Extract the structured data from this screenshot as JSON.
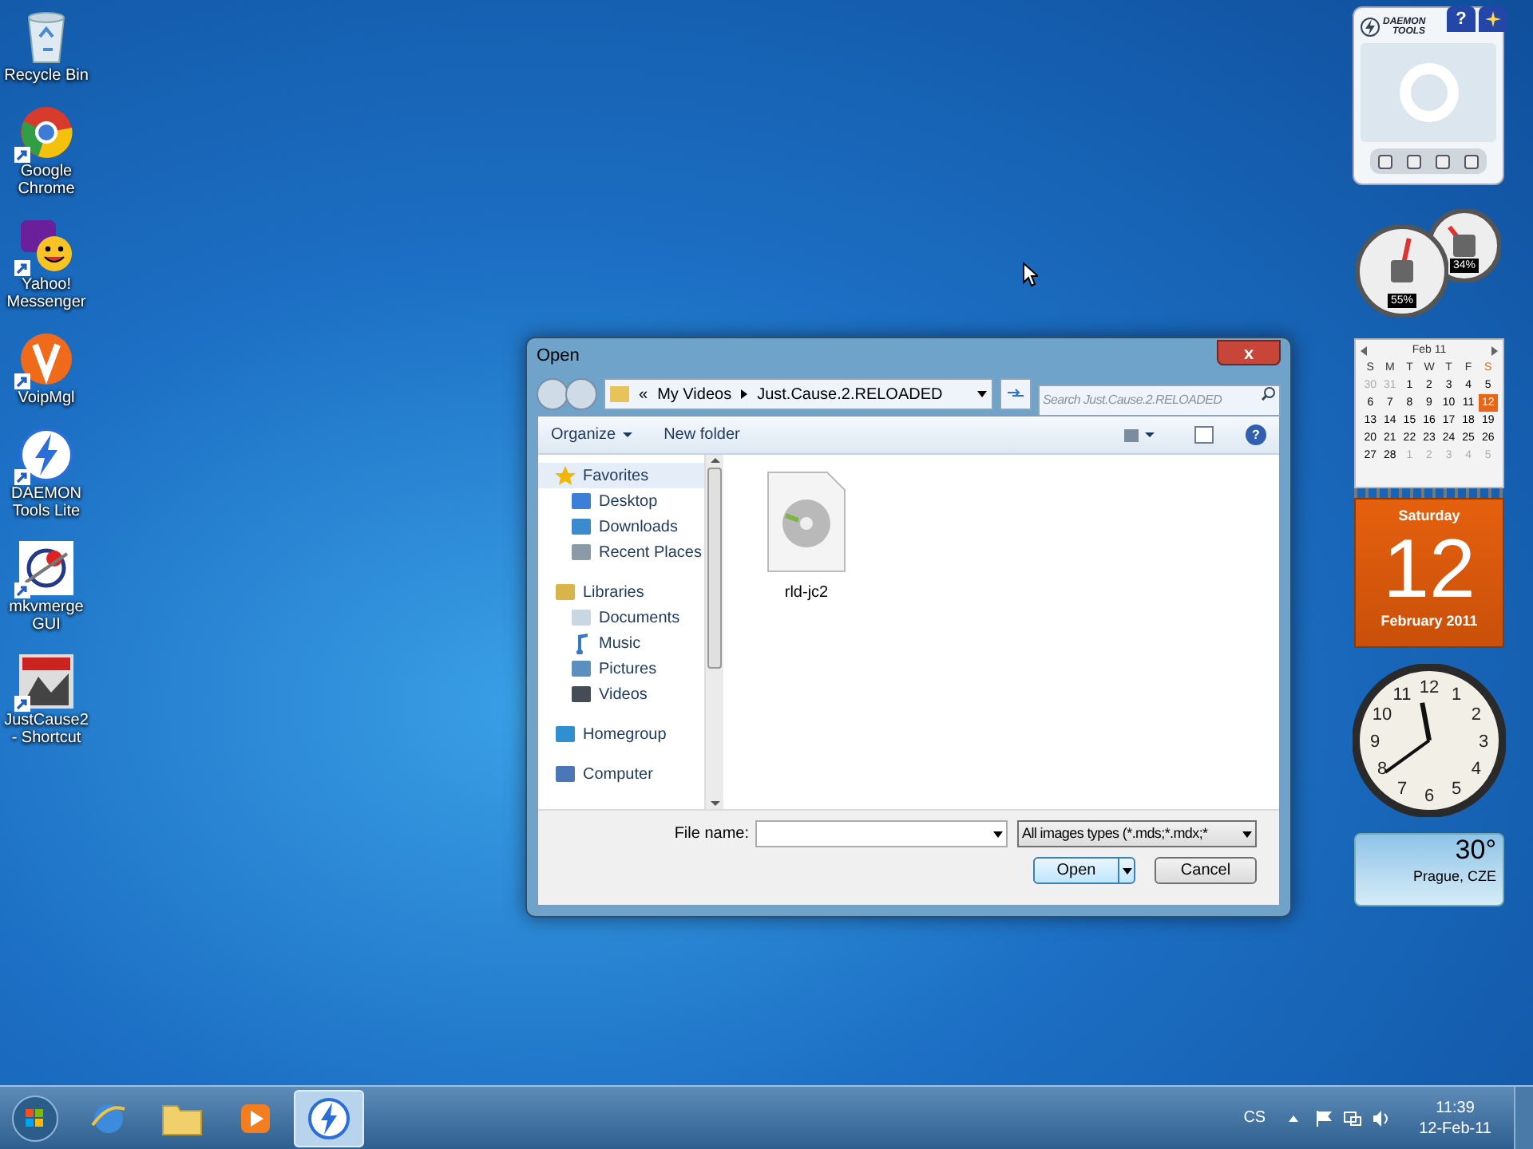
{
  "desktop_icons": [
    {
      "label": "Recycle Bin",
      "shortcut": false
    },
    {
      "label": "Google Chrome",
      "shortcut": true
    },
    {
      "label": "Yahoo! Messenger",
      "shortcut": true
    },
    {
      "label": "VoipMgl",
      "shortcut": true
    },
    {
      "label": "DAEMON Tools Lite",
      "shortcut": true
    },
    {
      "label": "mkvmerge GUI",
      "shortcut": true
    },
    {
      "label": "JustCause2 - Shortcut",
      "shortcut": true
    }
  ],
  "dialog": {
    "title": "Open",
    "close": "x",
    "breadcrumb": [
      "«",
      "My Videos",
      "Just.Cause.2.RELOADED"
    ],
    "search": {
      "placeholder": "Search Just.Cause.2.RELOADED"
    },
    "toolbar": [
      "Organize",
      "New folder"
    ],
    "nav": [
      {
        "label": "Favorites",
        "selected": true,
        "children": [
          {
            "label": "Desktop",
            "selected": false
          },
          {
            "label": "Downloads",
            "selected": false
          },
          {
            "label": "Recent Places",
            "selected": false
          }
        ]
      },
      {
        "label": "Libraries",
        "selected": false,
        "children": [
          {
            "label": "Documents",
            "selected": false
          },
          {
            "label": "Music",
            "selected": false
          },
          {
            "label": "Pictures",
            "selected": false
          },
          {
            "label": "Videos",
            "selected": false
          }
        ]
      },
      {
        "label": "Homegroup",
        "selected": false
      },
      {
        "label": "Computer",
        "selected": false
      }
    ],
    "files": [
      {
        "name": "rld-jc2"
      }
    ],
    "help": "?",
    "file_name": {
      "label": "File name:"
    },
    "filter": "All images types (*.mds;*.mdx;*",
    "buttons": [
      {
        "label": "Open",
        "kind": "split"
      },
      {
        "label": "Cancel",
        "kind": "plain"
      }
    ]
  },
  "gadgets": {
    "daemon": {
      "logo": [
        "DAEMON",
        "TOOLS"
      ],
      "help": "?"
    },
    "meters": [
      {
        "reading": "55%",
        "level": 0.55
      },
      {
        "reading": "34%",
        "level": 0.34
      }
    ],
    "calendar": {
      "month": "Feb 11",
      "weekdays": [
        "S",
        "M",
        "T",
        "W",
        "T",
        "F",
        "S"
      ],
      "weeks": [
        [
          {
            "d": "30",
            "muted": true,
            "selected": false
          },
          {
            "d": "31",
            "muted": true,
            "selected": false
          },
          {
            "d": "1",
            "muted": false,
            "selected": false
          },
          {
            "d": "2",
            "muted": false,
            "selected": false
          },
          {
            "d": "3",
            "muted": false,
            "selected": false
          },
          {
            "d": "4",
            "muted": false,
            "selected": false
          },
          {
            "d": "5",
            "muted": false,
            "selected": false
          }
        ],
        [
          {
            "d": "6",
            "muted": false,
            "selected": false
          },
          {
            "d": "7",
            "muted": false,
            "selected": false
          },
          {
            "d": "8",
            "muted": false,
            "selected": false
          },
          {
            "d": "9",
            "muted": false,
            "selected": false
          },
          {
            "d": "10",
            "muted": false,
            "selected": false
          },
          {
            "d": "11",
            "muted": false,
            "selected": false
          },
          {
            "d": "12",
            "muted": false,
            "selected": true
          }
        ],
        [
          {
            "d": "13",
            "muted": false,
            "selected": false
          },
          {
            "d": "14",
            "muted": false,
            "selected": false
          },
          {
            "d": "15",
            "muted": false,
            "selected": false
          },
          {
            "d": "16",
            "muted": false,
            "selected": false
          },
          {
            "d": "17",
            "muted": false,
            "selected": false
          },
          {
            "d": "18",
            "muted": false,
            "selected": false
          },
          {
            "d": "19",
            "muted": false,
            "selected": false
          }
        ],
        [
          {
            "d": "20",
            "muted": false,
            "selected": false
          },
          {
            "d": "21",
            "muted": false,
            "selected": false
          },
          {
            "d": "22",
            "muted": false,
            "selected": false
          },
          {
            "d": "23",
            "muted": false,
            "selected": false
          },
          {
            "d": "24",
            "muted": false,
            "selected": false
          },
          {
            "d": "25",
            "muted": false,
            "selected": false
          },
          {
            "d": "26",
            "muted": false,
            "selected": false
          }
        ],
        [
          {
            "d": "27",
            "muted": false,
            "selected": false
          },
          {
            "d": "28",
            "muted": false,
            "selected": false
          },
          {
            "d": "1",
            "muted": true,
            "selected": false
          },
          {
            "d": "2",
            "muted": true,
            "selected": false
          },
          {
            "d": "3",
            "muted": true,
            "selected": false
          },
          {
            "d": "4",
            "muted": true,
            "selected": false
          },
          {
            "d": "5",
            "muted": true,
            "selected": false
          }
        ]
      ],
      "day_name": "Saturday",
      "day": "12",
      "month_year": "February 2011"
    },
    "clock": {
      "numerals": [
        "12",
        "11",
        "1",
        "10",
        "2",
        "9",
        "3",
        "8",
        "4",
        "7",
        "5",
        "6"
      ]
    },
    "weather": {
      "temperature": "30°",
      "city": "Prague, CZE"
    }
  },
  "taskbar": {
    "apps": [
      {
        "kind": "ie",
        "selected": false
      },
      {
        "kind": "explorer",
        "selected": false
      },
      {
        "kind": "media",
        "selected": false
      },
      {
        "kind": "daemon",
        "selected": true
      }
    ],
    "language": "CS",
    "time": "11:39",
    "date": "12-Feb-11"
  }
}
